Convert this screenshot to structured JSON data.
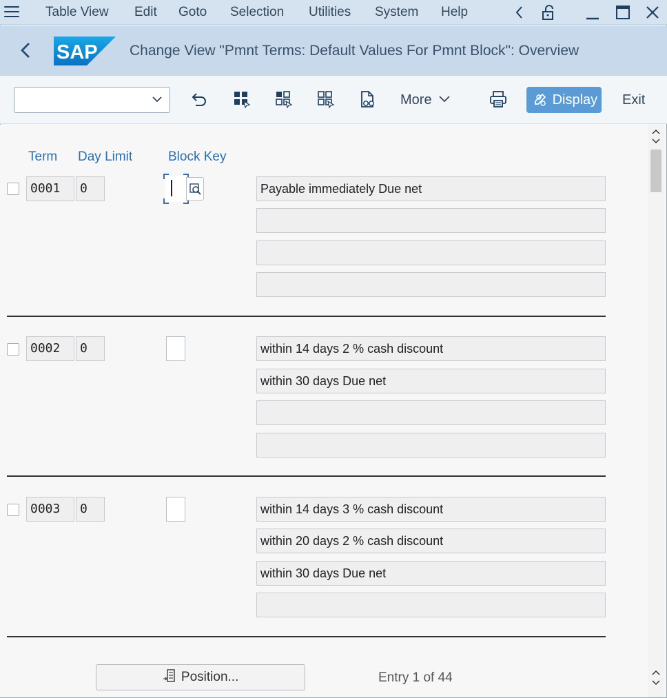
{
  "menubar": {
    "items": [
      "Table View",
      "Edit",
      "Goto",
      "Selection",
      "Utilities",
      "System",
      "Help"
    ]
  },
  "titlebar": {
    "logo_text": "SAP",
    "title": "Change View \"Pmnt Terms: Default Values For Pmnt Block\": Overview"
  },
  "toolbar": {
    "command_field_value": "",
    "more_label": "More",
    "display_label": "Display",
    "exit_label": "Exit",
    "icons": [
      "undo-icon",
      "select-all-icon",
      "select-block-icon",
      "deselect-all-icon",
      "document-glasses-icon",
      "print-icon"
    ]
  },
  "columns": {
    "term": "Term",
    "day_limit": "Day Limit",
    "block_key": "Block Key"
  },
  "entries": [
    {
      "term": "0001",
      "day_limit": "0",
      "block_key": "",
      "texts": [
        "Payable immediately Due net",
        "",
        "",
        ""
      ]
    },
    {
      "term": "0002",
      "day_limit": "0",
      "block_key": "",
      "texts": [
        "within 14 days 2 % cash discount",
        "within 30 days Due net",
        "",
        ""
      ]
    },
    {
      "term": "0003",
      "day_limit": "0",
      "block_key": "",
      "texts": [
        "within 14 days 3 % cash discount",
        "within 20 days 2 % cash discount",
        "within 30 days Due net",
        ""
      ]
    }
  ],
  "footer": {
    "position_label": "Position...",
    "entry_info": "Entry 1 of 44"
  },
  "colors": {
    "menubar_bg": "#d5e3f0",
    "titlebar_bg": "#c7d9eb",
    "accent": "#5a9bd5",
    "header_text": "#2c6fb0"
  }
}
